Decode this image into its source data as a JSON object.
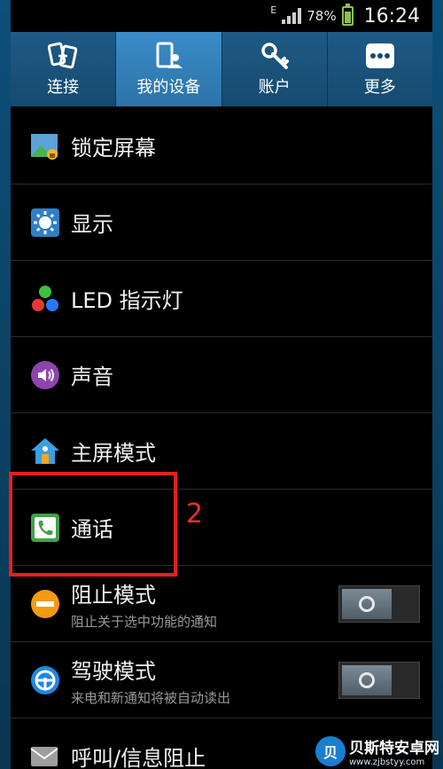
{
  "status_bar": {
    "network": "E",
    "battery": "78%",
    "time": "16:24"
  },
  "tabs": [
    {
      "label": "连接",
      "icon": "connection-icon",
      "active": false
    },
    {
      "label": "我的设备",
      "icon": "my-device-icon",
      "active": true
    },
    {
      "label": "账户",
      "icon": "account-key-icon",
      "active": false
    },
    {
      "label": "更多",
      "icon": "more-icon",
      "active": false
    }
  ],
  "items": [
    {
      "label": "锁定屏幕",
      "icon": "lock-screen-icon"
    },
    {
      "label": "显示",
      "icon": "display-icon"
    },
    {
      "label": "LED 指示灯",
      "icon": "led-indicator-icon"
    },
    {
      "label": "声音",
      "icon": "sound-icon"
    },
    {
      "label": "主屏模式",
      "icon": "home-screen-mode-icon"
    },
    {
      "label": "通话",
      "icon": "call-icon"
    },
    {
      "label": "阻止模式",
      "sub": "阻止关于选中功能的通知",
      "icon": "blocking-mode-icon",
      "toggle": "off"
    },
    {
      "label": "驾驶模式",
      "sub": "来电和新通知将被自动读出",
      "icon": "driving-mode-icon",
      "toggle": "off"
    },
    {
      "label": "呼叫/信息阻止",
      "icon": "call-block-icon"
    }
  ],
  "annotation": {
    "number": "2",
    "color": "#e32020"
  },
  "watermark": {
    "title": "贝斯特安卓网",
    "url": "www.zjbstyy.com",
    "logo": "贝"
  }
}
